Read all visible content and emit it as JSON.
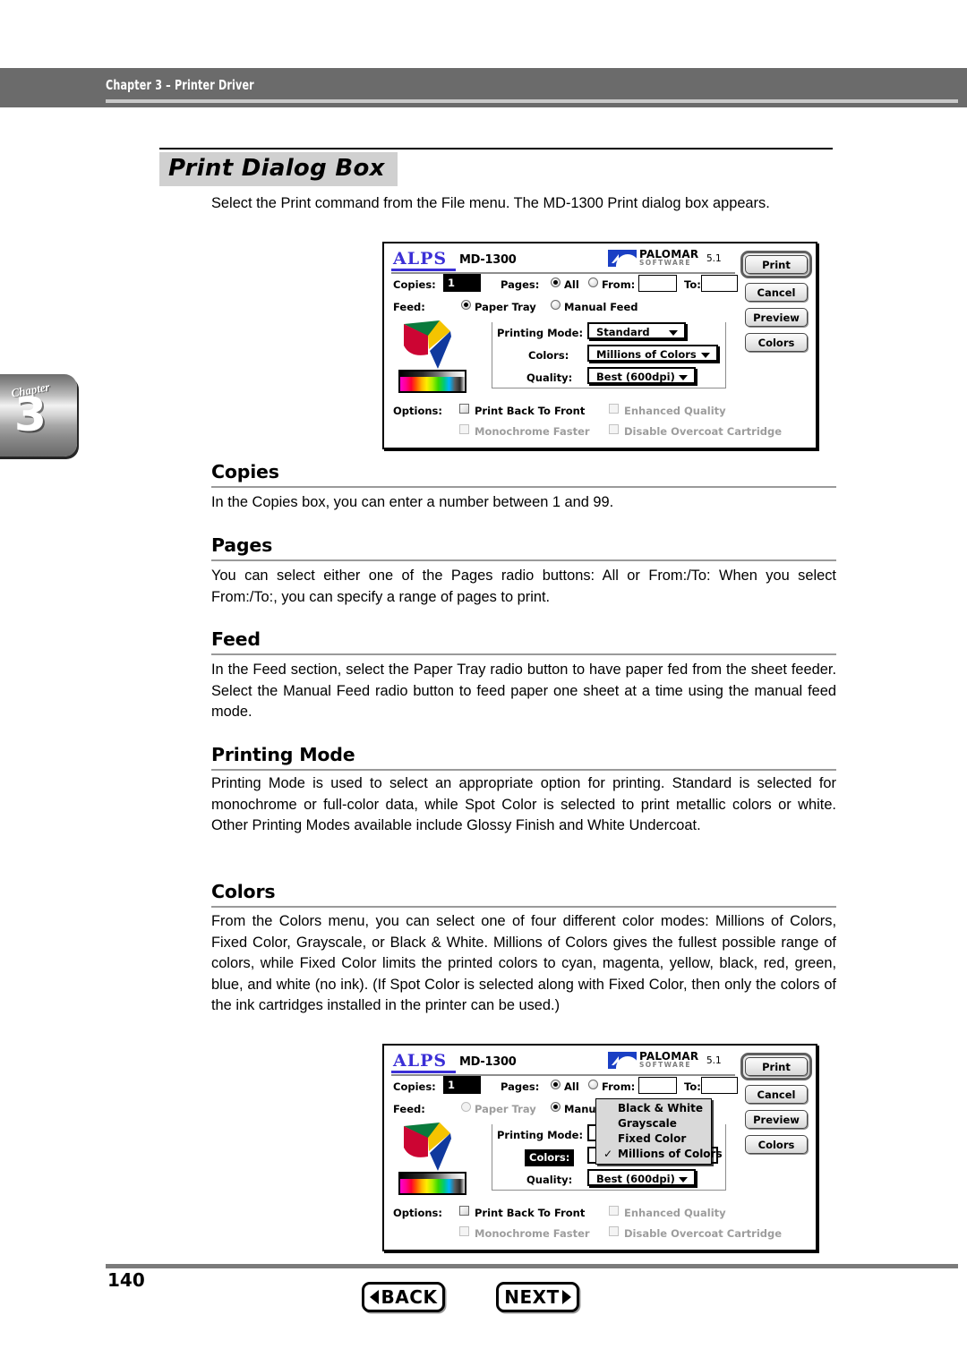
{
  "header": {
    "running_head": "Chapter 3 – Printer Driver"
  },
  "chapter_tab": {
    "word": "Chapter",
    "number": "3"
  },
  "page_title": "Print Dialog Box",
  "intro": "Select the Print command from the File menu.  The MD-1300 Print dialog box appears.",
  "sections": [
    {
      "heading": "Copies",
      "body": "In the Copies box, you can enter a number between 1 and 99."
    },
    {
      "heading": "Pages",
      "body": "You can select either one of the Pages radio buttons: All or From:/To:  When you select From:/To:, you can specify a range of pages to print."
    },
    {
      "heading": "Feed",
      "body": "In the Feed section, select the Paper Tray radio button to have paper fed from the sheet feeder. Select the Manual Feed radio button to feed paper one sheet at a time using the manual feed mode."
    },
    {
      "heading": "Printing Mode",
      "body": "Printing Mode is used to select an appropriate option for printing. Standard is selected for monochrome or full-color data, while Spot Color is selected to print metallic colors or white. Other Printing Modes available include Glossy Finish and White Undercoat."
    },
    {
      "heading": "Colors",
      "body": "From the Colors menu, you can select one of four different color modes: Millions of Colors, Fixed Color, Grayscale, or Black & White.  Millions of Colors gives the fullest possible range of colors, while Fixed Color limits the printed colors to cyan, magenta, yellow, black, red, green, blue, and white (no ink). (If Spot Color is selected along with Fixed Color, then only the colors of the ink cartridges installed in the printer can be used.)"
    }
  ],
  "dialog1": {
    "brand": "ALPS",
    "model": "MD-1300",
    "partner_name": "PALOMAR",
    "partner_sub": "SOFTWARE",
    "version": "5.1",
    "copies_label": "Copies:",
    "copies_value": "1",
    "pages_label": "Pages:",
    "pages_all": "All",
    "pages_from": "From:",
    "pages_to": "To:",
    "from_value": "",
    "to_value": "",
    "feed_label": "Feed:",
    "feed_paper_tray": "Paper Tray",
    "feed_manual": "Manual Feed",
    "printing_mode_label": "Printing Mode:",
    "printing_mode_value": "Standard",
    "colors_label": "Colors:",
    "colors_value": "Millions of Colors",
    "quality_label": "Quality:",
    "quality_value": "Best (600dpi)",
    "options_label": "Options:",
    "opt_print_back": "Print Back To Front",
    "opt_enhanced": "Enhanced Quality",
    "opt_mono_faster": "Monochrome Faster",
    "opt_disable_overcoat": "Disable Overcoat Cartridge",
    "btn_print": "Print",
    "btn_cancel": "Cancel",
    "btn_preview": "Preview",
    "btn_colors": "Colors"
  },
  "dialog2": {
    "brand": "ALPS",
    "model": "MD-1300",
    "partner_name": "PALOMAR",
    "partner_sub": "SOFTWARE",
    "version": "5.1",
    "copies_label": "Copies:",
    "copies_value": "1",
    "pages_label": "Pages:",
    "pages_all": "All",
    "pages_from": "From:",
    "pages_to": "To:",
    "feed_label": "Feed:",
    "feed_paper_tray": "Paper Tray",
    "feed_manual": "Manual Feed",
    "printing_mode_label": "Printing Mode:",
    "colors_label": "Colors:",
    "quality_label": "Quality:",
    "quality_value": "Best (600dpi)",
    "options_label": "Options:",
    "opt_print_back": "Print Back To Front",
    "opt_enhanced": "Enhanced Quality",
    "opt_mono_faster": "Monochrome Faster",
    "opt_disable_overcoat": "Disable Overcoat Cartridge",
    "btn_print": "Print",
    "btn_cancel": "Cancel",
    "btn_preview": "Preview",
    "btn_colors": "Colors",
    "colors_menu": {
      "items": [
        {
          "label": "Black & White",
          "checked": false
        },
        {
          "label": "Grayscale",
          "checked": false
        },
        {
          "label": "Fixed Color",
          "checked": false
        },
        {
          "label": "Millions of Colors",
          "checked": true
        }
      ],
      "check_glyph": "✓"
    }
  },
  "footer": {
    "page_number": "140",
    "back_label": "BACK",
    "next_label": "NEXT"
  }
}
